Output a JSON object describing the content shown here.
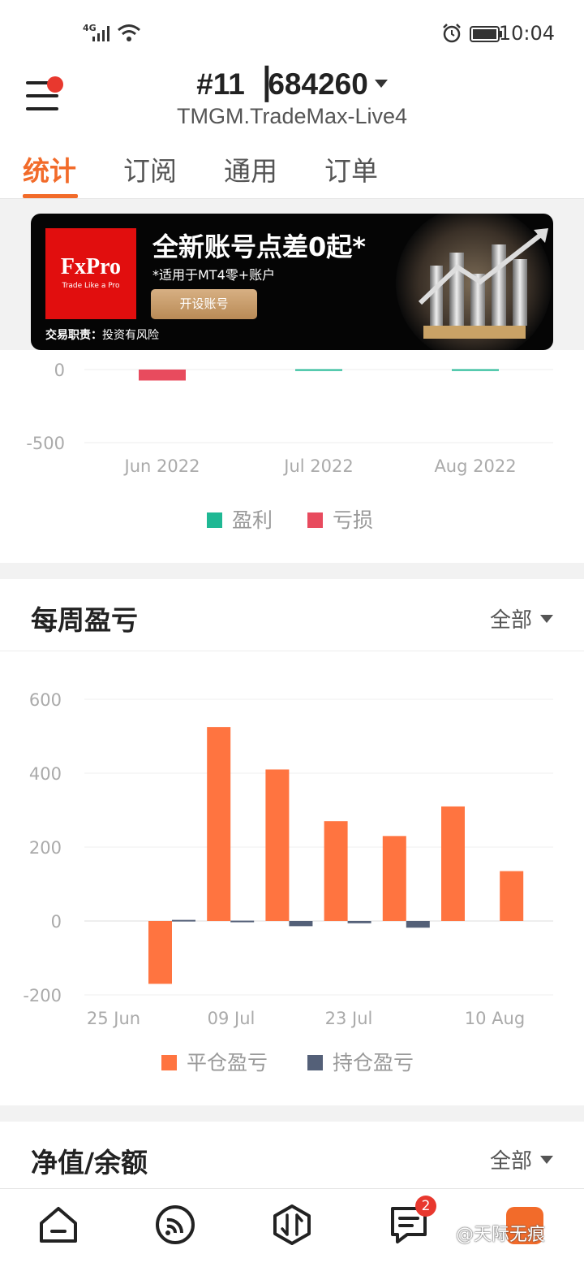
{
  "status_bar": {
    "network": "4G",
    "time": "10:04"
  },
  "header": {
    "account_number": "#11▕684260",
    "server": "TMGM.TradeMax-Live4",
    "tabs": [
      "统计",
      "订阅",
      "通用",
      "订单"
    ],
    "active_tab": 0
  },
  "ad": {
    "brand": "FxPro",
    "brand_tagline": "Trade Like a Pro",
    "headline": "全新账号点差0起*",
    "subline": "*适用于MT4零+账户",
    "button": "开设账号",
    "risk_label": "交易职责：",
    "risk_text": "投资有风险"
  },
  "monthly_chart": {
    "legend": [
      {
        "label": "盈利",
        "color": "#1fb894"
      },
      {
        "label": "亏损",
        "color": "#e84b5e"
      }
    ],
    "chart_data": {
      "type": "bar",
      "categories": [
        "Jun 2022",
        "Jul 2022",
        "Aug 2022"
      ],
      "y_ticks": [
        "0",
        "-500"
      ],
      "series": [
        {
          "name": "盈利",
          "values": [
            0,
            2,
            2
          ]
        },
        {
          "name": "亏损",
          "values": [
            -75,
            0,
            0
          ]
        }
      ]
    }
  },
  "weekly": {
    "title": "每周盈亏",
    "filter": "全部",
    "legend": [
      {
        "label": "平仓盈亏",
        "color": "#ff7440"
      },
      {
        "label": "持仓盈亏",
        "color": "#546078"
      }
    ],
    "chart_data": {
      "type": "bar",
      "x_ticks": [
        "25 Jun",
        "09 Jul",
        "23 Jul",
        "10 Aug"
      ],
      "y_ticks": [
        "600",
        "400",
        "200",
        "0",
        "-200"
      ],
      "ylim": [
        -200,
        600
      ],
      "weeks": 7,
      "series": [
        {
          "name": "平仓盈亏",
          "values": [
            -170,
            525,
            410,
            270,
            230,
            310,
            135
          ]
        },
        {
          "name": "持仓盈亏",
          "values": [
            3,
            1,
            -14,
            -6,
            -18,
            0,
            0
          ]
        }
      ]
    }
  },
  "equity": {
    "title": "净值/余额",
    "filter": "全部"
  },
  "bottom_nav": {
    "badge": "2",
    "watermark": "@天际无痕"
  }
}
